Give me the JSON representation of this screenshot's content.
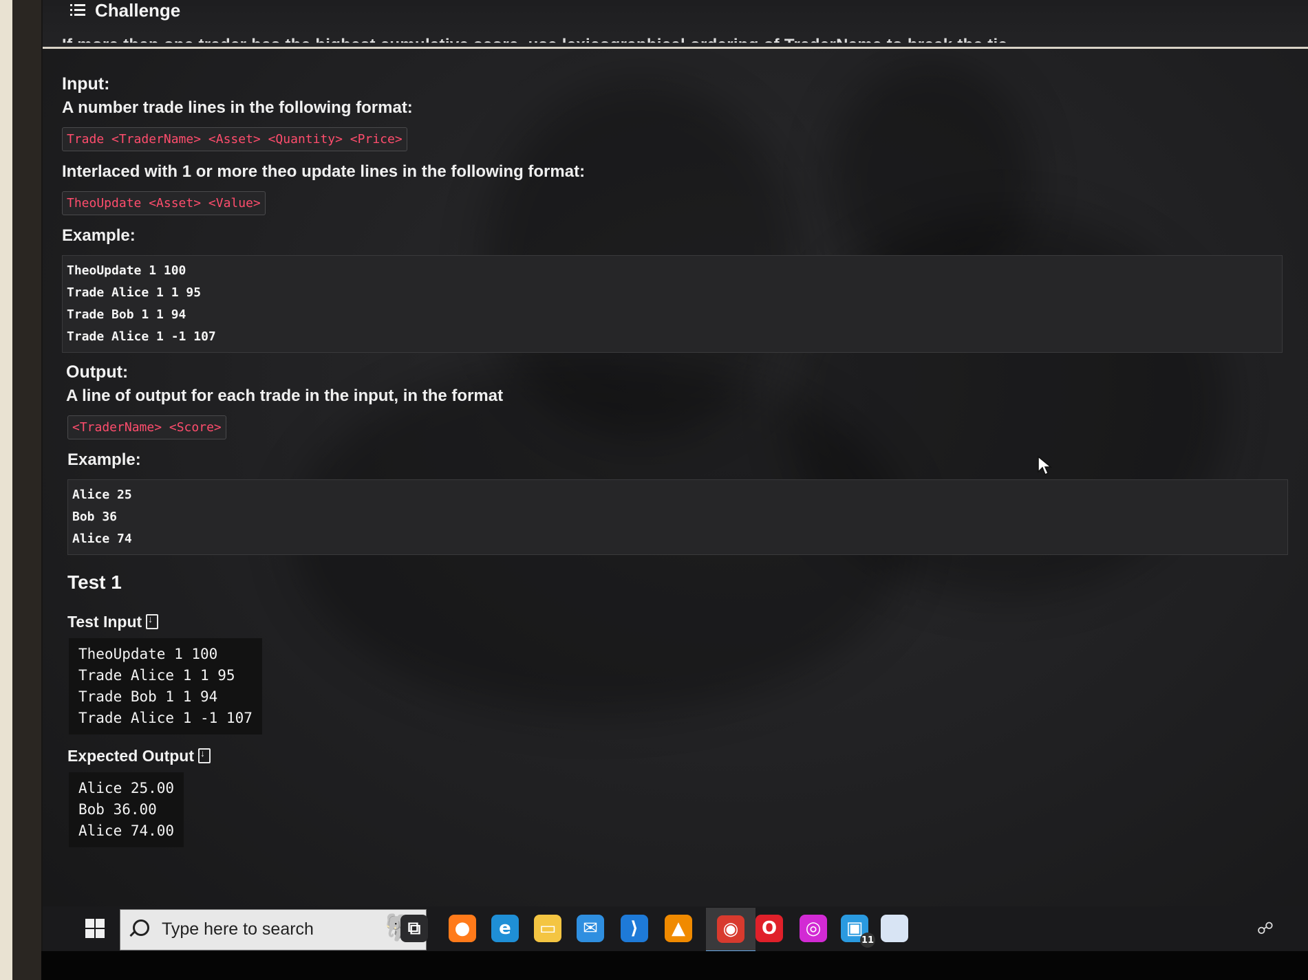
{
  "header": {
    "title": "Challenge",
    "cutoff_text": "If more than one trader has the highest cumulative score, use lexicographical ordering of TraderName to break the tie."
  },
  "input_section": {
    "heading": "Input:",
    "desc": "A number trade lines in the following format:",
    "trade_format": "Trade <TraderName> <Asset> <Quantity> <Price>",
    "interlace_desc": "Interlaced with 1 or more theo update lines in the following format:",
    "theo_format": "TheoUpdate <Asset> <Value>",
    "example_label": "Example:",
    "example_lines": [
      "TheoUpdate 1 100",
      "Trade Alice 1 1 95",
      "Trade Bob 1 1 94",
      "Trade Alice 1 -1 107"
    ]
  },
  "output_section": {
    "heading": "Output:",
    "desc": "A line of output for each trade in the input, in the format",
    "format": "<TraderName> <Score>",
    "example_label": "Example:",
    "example_lines": [
      "Alice 25",
      "Bob 36",
      "Alice 74"
    ]
  },
  "test": {
    "title": "Test 1",
    "input_label": "Test Input",
    "input_lines": [
      "TheoUpdate 1 100",
      "Trade Alice 1 1 95",
      "Trade Bob 1 1 94",
      "Trade Alice 1 -1 107"
    ],
    "expected_label": "Expected Output",
    "expected_lines": [
      "Alice 25.00",
      "Bob 36.00",
      "Alice 74.00"
    ]
  },
  "taskbar": {
    "search_placeholder": "Type here to search",
    "icons": [
      {
        "name": "task-view-icon",
        "glyph": "⧉",
        "color": "#2b2b2d"
      },
      {
        "name": "firefox-icon",
        "glyph": "●",
        "color": "#ff7a1a"
      },
      {
        "name": "edge-icon",
        "glyph": "e",
        "color": "#1f8fd6"
      },
      {
        "name": "file-explorer-icon",
        "glyph": "▭",
        "color": "#f4c542"
      },
      {
        "name": "mail-icon",
        "glyph": "✉",
        "color": "#2f8fe0"
      },
      {
        "name": "vscode-icon",
        "glyph": "⟩",
        "color": "#1e7ad8"
      },
      {
        "name": "vlc-icon",
        "glyph": "▲",
        "color": "#f08a00"
      },
      {
        "name": "chrome-icon",
        "glyph": "◉",
        "color": "#d83a2e"
      },
      {
        "name": "opera-icon",
        "glyph": "O",
        "color": "#e0202a"
      },
      {
        "name": "messenger-icon",
        "glyph": "◎",
        "color": "#d22ad4"
      },
      {
        "name": "notification-app-icon",
        "glyph": "▣",
        "color": "#2a9ae0"
      },
      {
        "name": "blank-window-icon",
        "glyph": "",
        "color": "#d8e4f4"
      }
    ],
    "badge": "11"
  }
}
